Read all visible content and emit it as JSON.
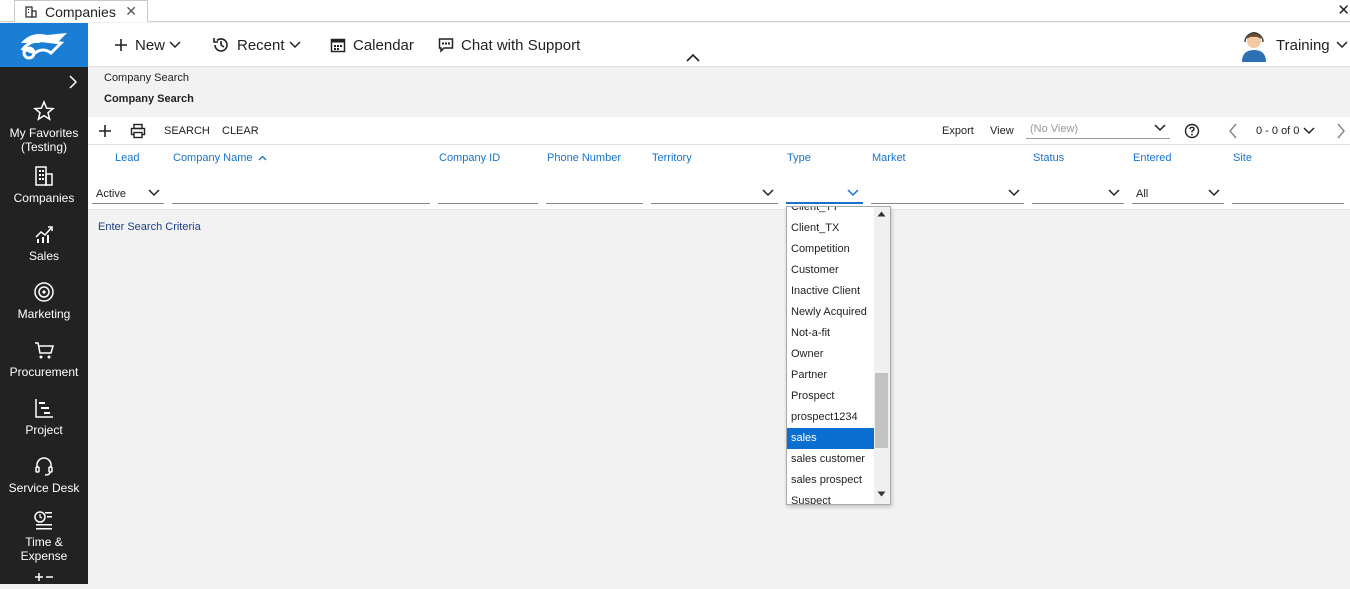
{
  "tab": {
    "title": "Companies",
    "close": "✕"
  },
  "window": {
    "close": "✕"
  },
  "sidebar": {
    "items": [
      {
        "label": "My Favorites\n(Testing)",
        "icon": "star-icon"
      },
      {
        "label": "Companies",
        "icon": "building-icon"
      },
      {
        "label": "Sales",
        "icon": "chart-up-icon"
      },
      {
        "label": "Marketing",
        "icon": "target-icon"
      },
      {
        "label": "Procurement",
        "icon": "cart-icon"
      },
      {
        "label": "Project",
        "icon": "gantt-icon"
      },
      {
        "label": "Service Desk",
        "icon": "headset-icon"
      },
      {
        "label": "Time &\nExpense",
        "icon": "timesheet-icon"
      }
    ]
  },
  "topbar": {
    "new_label": "New",
    "recent_label": "Recent",
    "calendar_label": "Calendar",
    "chat_label": "Chat with Support",
    "user_label": "Training"
  },
  "breadcrumb": "Company Search",
  "page_title": "Company Search",
  "toolbar": {
    "search_label": "SEARCH",
    "clear_label": "CLEAR",
    "export_label": "Export",
    "view_label": "View",
    "view_placeholder": "(No View)",
    "paging": "0 - 0 of 0"
  },
  "columns": {
    "lead": "Lead",
    "company_name": "Company Name",
    "company_id": "Company ID",
    "phone": "Phone Number",
    "territory": "Territory",
    "type": "Type",
    "market": "Market",
    "status": "Status",
    "entered": "Entered",
    "site": "Site"
  },
  "filters": {
    "lead_value": "Active",
    "entered_value": "All"
  },
  "hint": "Enter Search Criteria",
  "type_dropdown": {
    "options": [
      "Client_TT",
      "Client_TX",
      "Competition",
      "Customer",
      "Inactive Client",
      "Newly Acquired",
      "Not-a-fit",
      "Owner",
      "Partner",
      "Prospect",
      "prospect1234",
      "sales",
      "sales customer",
      "sales prospect",
      "Suspect"
    ],
    "selected": "sales"
  },
  "colors": {
    "accent": "#1a72c8",
    "sidebar": "#222222",
    "logo_bg": "#1a7fd4",
    "selected": "#0a6fd1"
  }
}
